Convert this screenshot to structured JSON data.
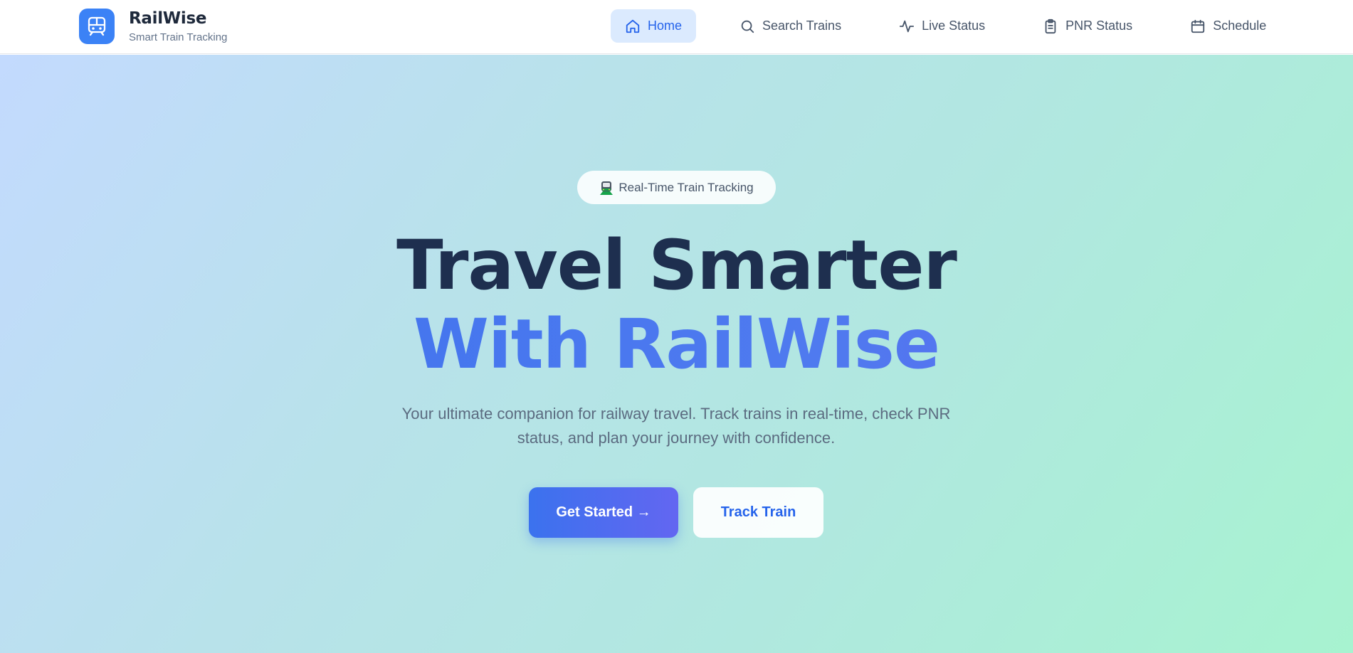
{
  "brand": {
    "name": "RailWise",
    "tagline": "Smart Train Tracking",
    "icon": "train-icon"
  },
  "nav": {
    "items": [
      {
        "label": "Home",
        "icon": "home-icon",
        "active": true
      },
      {
        "label": "Search Trains",
        "icon": "search-icon",
        "active": false
      },
      {
        "label": "Live Status",
        "icon": "activity-icon",
        "active": false
      },
      {
        "label": "PNR Status",
        "icon": "clipboard-icon",
        "active": false
      },
      {
        "label": "Schedule",
        "icon": "calendar-icon",
        "active": false
      }
    ]
  },
  "hero": {
    "badge": "Real-Time Train Tracking",
    "badge_icon": "locomotive-emoji",
    "headline_line1": "Travel Smarter",
    "headline_line2": "With RailWise",
    "subtitle": "Your ultimate companion for railway travel. Track trains in real-time, check PNR status, and plan your journey with confidence.",
    "primary_button": "Get Started →",
    "secondary_button": "Track Train"
  },
  "colors": {
    "accent": "#3b82f6",
    "headline_dark": "#1e2f4f",
    "active_nav_bg": "#dbeafe",
    "active_nav_text": "#2563eb"
  }
}
